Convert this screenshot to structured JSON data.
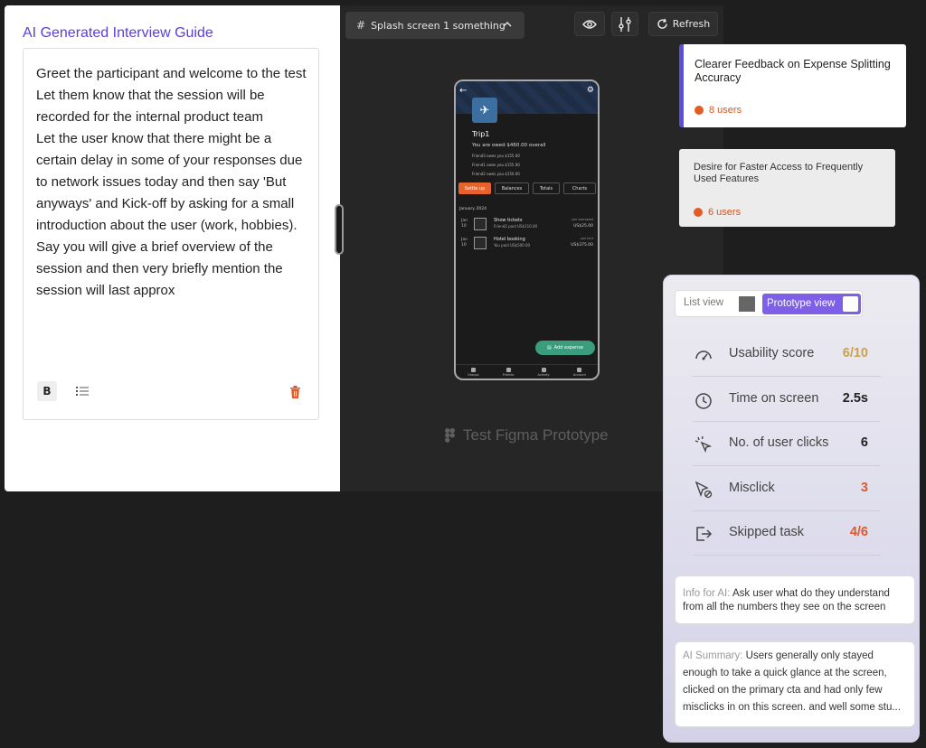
{
  "guide": {
    "title": "AI Generated Interview Guide",
    "paragraphs": [
      " Greet the participant and welcome to the test",
      " Let them know that the session will be recorded for the internal product team",
      "Let the user know that there might be a certain delay in some of your responses due to network issues today and then say 'But anyways' and Kick-off by asking for a small introduction about the user (work, hobbies).",
      "Say you will give a brief overview of the session and then very briefly mention the session will last approx"
    ],
    "bold_label": "B"
  },
  "toolbar": {
    "screen_name": "Splash screen 1 something",
    "refresh_label": "Refresh"
  },
  "phone": {
    "trip_name": "Trip1",
    "owed_summary": "You are owed $460.00 overall",
    "owes_lines": [
      "Friend3 owes you $155.00",
      "Friend1 owes you $155.00",
      "Friend2 owes you $150.00"
    ],
    "tabs": [
      "Settle up",
      "Balances",
      "Totals",
      "Charts"
    ],
    "month": "January 2024",
    "expenses": [
      {
        "date": "Jan\n10",
        "name": "Show tickets",
        "sub": "Friend2 paid US$110.00",
        "right_top": "you borrowed",
        "right": "US$25.00"
      },
      {
        "date": "Jan\n10",
        "name": "Hotel booking",
        "sub": "You paid US$500.00",
        "right_top": "you lent",
        "right": "US$375.00"
      }
    ],
    "add_expense": "Add expense",
    "nav": [
      "Groups",
      "Friends",
      "Activity",
      "Account"
    ]
  },
  "prototype_label": "Test Figma Prototype",
  "feedback": [
    {
      "title": "Clearer Feedback on Expense Splitting Accuracy",
      "users": "8 users"
    },
    {
      "title": "Desire for Faster Access to Frequently Used Features",
      "users": "6 users"
    }
  ],
  "metrics_panel": {
    "list_view": "List view",
    "prototype_view": "Prototype view",
    "rows": [
      {
        "icon": "gauge-icon",
        "label": "Usability score",
        "value": "6/10",
        "color": "#c9a24a"
      },
      {
        "icon": "clock-icon",
        "label": "Time on screen",
        "value": "2.5s",
        "color": "#222222"
      },
      {
        "icon": "click-icon",
        "label": "No. of user clicks",
        "value": "6",
        "color": "#222222"
      },
      {
        "icon": "cursor-slash-icon",
        "label": "Misclick",
        "value": "3",
        "color": "#e2572a"
      },
      {
        "icon": "exit-icon",
        "label": "Skipped task",
        "value": "4/6",
        "color": "#e2572a"
      }
    ],
    "ai_info_prefix": "Info for AI:",
    "ai_info_text": "Ask user what do they understand from all the numbers they see on the screen",
    "ai_summary_prefix": "AI Summary:",
    "ai_summary_text": "Users generally only stayed enough to take a quick glance at the screen, clicked on the primary cta and had only few misclicks in on this screen. and well some stu..."
  },
  "colors": {
    "accent": "#5b3fd6",
    "toggle": "#7d5fe8",
    "warning": "#e2572a",
    "score": "#c9a24a"
  }
}
